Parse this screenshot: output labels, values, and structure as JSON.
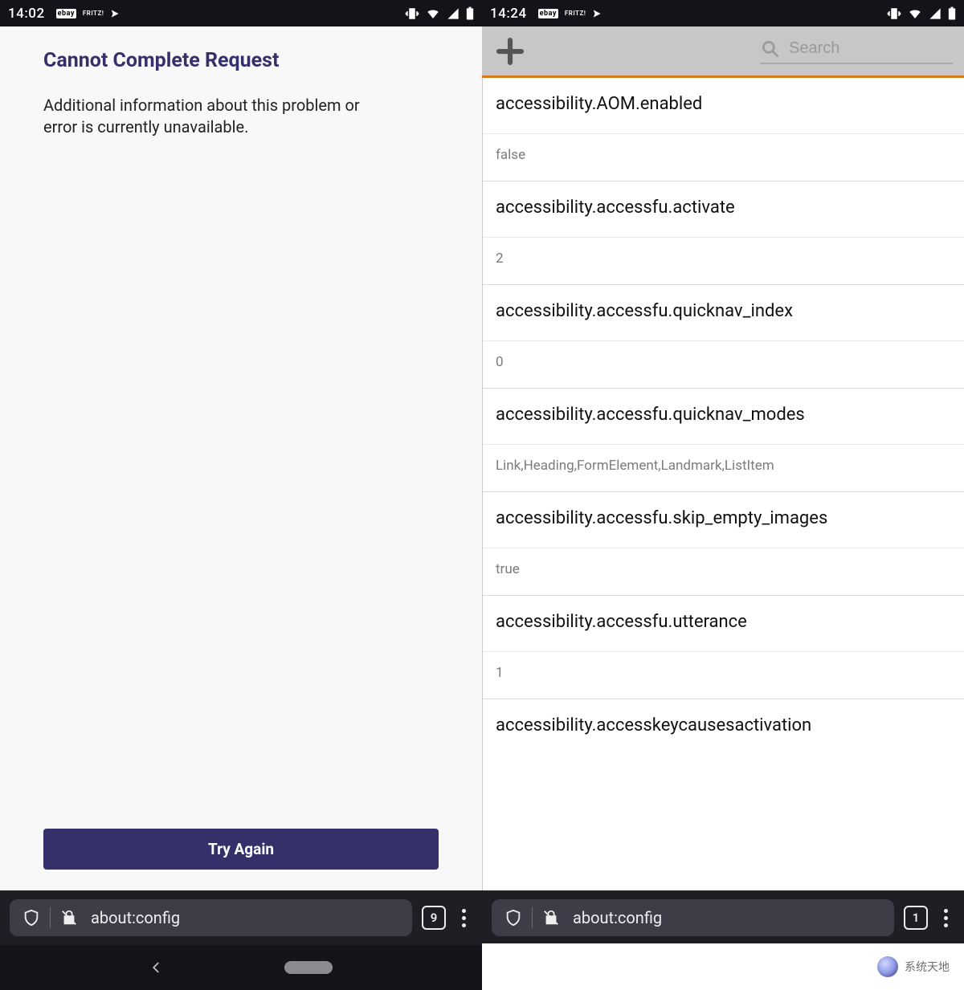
{
  "left": {
    "status": {
      "time": "14:02",
      "ebay": "ebay",
      "fritz": "FRITZ!"
    },
    "error": {
      "title": "Cannot Complete Request",
      "body": "Additional information about this problem or error is currently unavailable.",
      "try_again": "Try Again"
    },
    "ff": {
      "url": "about:config",
      "tabs": "9"
    }
  },
  "right": {
    "status": {
      "time": "14:24",
      "ebay": "ebay",
      "fritz": "FRITZ!"
    },
    "toolbar": {
      "search_placeholder": "Search"
    },
    "prefs": [
      {
        "key": "accessibility.AOM.enabled",
        "value": "false"
      },
      {
        "key": "accessibility.accessfu.activate",
        "value": "2"
      },
      {
        "key": "accessibility.accessfu.quicknav_index",
        "value": "0"
      },
      {
        "key": "accessibility.accessfu.quicknav_modes",
        "value": "Link,Heading,FormElement,Landmark,ListItem"
      },
      {
        "key": "accessibility.accessfu.skip_empty_images",
        "value": "true"
      },
      {
        "key": "accessibility.accessfu.utterance",
        "value": "1"
      },
      {
        "key": "accessibility.accesskeycausesactivation",
        "value": ""
      }
    ],
    "ff": {
      "url": "about:config",
      "tabs": "1"
    }
  },
  "watermark": "系统天地"
}
